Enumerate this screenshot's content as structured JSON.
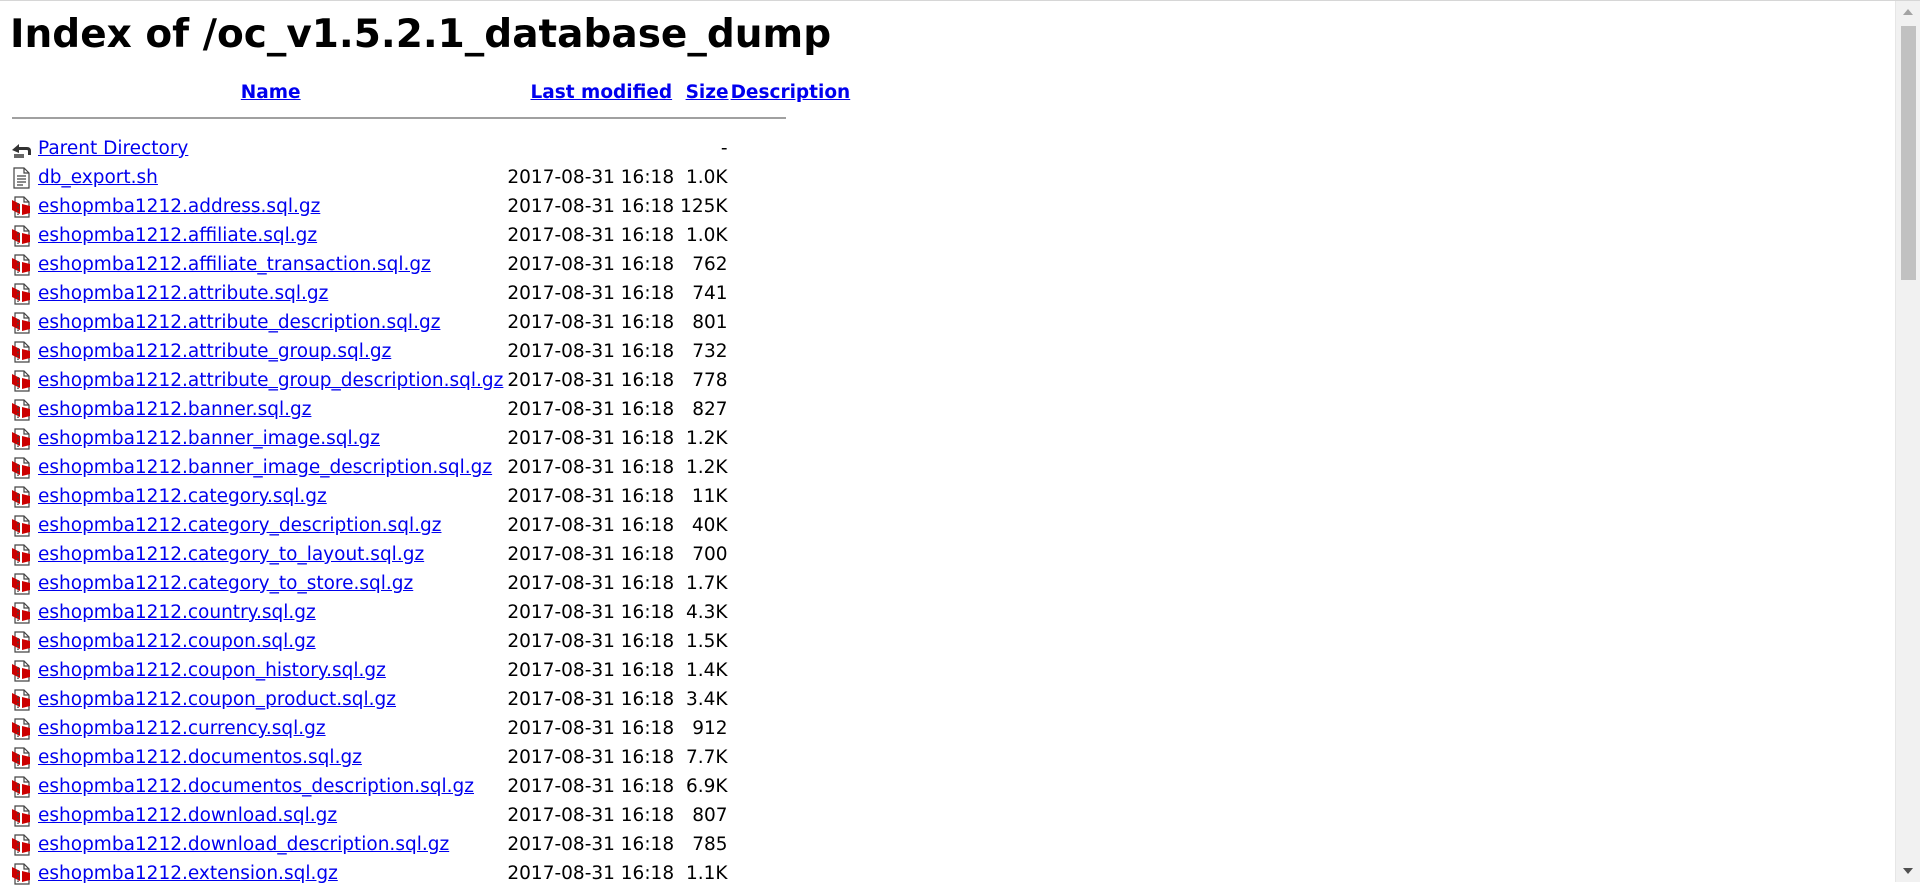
{
  "page": {
    "title": "Index of /oc_v1.5.2.1_database_dump"
  },
  "table": {
    "headers": {
      "name": "Name",
      "last_modified": "Last modified",
      "size": "Size",
      "description": "Description"
    },
    "parent": {
      "name": "Parent Directory",
      "size": "-",
      "icon": "back-icon"
    },
    "rows": [
      {
        "name": "db_export.sh",
        "date": "2017-08-31 16:18",
        "size": "1.0K",
        "icon": "text-file-icon"
      },
      {
        "name": "eshopmba1212.address.sql.gz",
        "date": "2017-08-31 16:18",
        "size": "125K",
        "icon": "compressed-file-icon"
      },
      {
        "name": "eshopmba1212.affiliate.sql.gz",
        "date": "2017-08-31 16:18",
        "size": "1.0K",
        "icon": "compressed-file-icon"
      },
      {
        "name": "eshopmba1212.affiliate_transaction.sql.gz",
        "date": "2017-08-31 16:18",
        "size": "762",
        "icon": "compressed-file-icon"
      },
      {
        "name": "eshopmba1212.attribute.sql.gz",
        "date": "2017-08-31 16:18",
        "size": "741",
        "icon": "compressed-file-icon"
      },
      {
        "name": "eshopmba1212.attribute_description.sql.gz",
        "date": "2017-08-31 16:18",
        "size": "801",
        "icon": "compressed-file-icon"
      },
      {
        "name": "eshopmba1212.attribute_group.sql.gz",
        "date": "2017-08-31 16:18",
        "size": "732",
        "icon": "compressed-file-icon"
      },
      {
        "name": "eshopmba1212.attribute_group_description.sql.gz",
        "date": "2017-08-31 16:18",
        "size": "778",
        "icon": "compressed-file-icon"
      },
      {
        "name": "eshopmba1212.banner.sql.gz",
        "date": "2017-08-31 16:18",
        "size": "827",
        "icon": "compressed-file-icon"
      },
      {
        "name": "eshopmba1212.banner_image.sql.gz",
        "date": "2017-08-31 16:18",
        "size": "1.2K",
        "icon": "compressed-file-icon"
      },
      {
        "name": "eshopmba1212.banner_image_description.sql.gz",
        "date": "2017-08-31 16:18",
        "size": "1.2K",
        "icon": "compressed-file-icon"
      },
      {
        "name": "eshopmba1212.category.sql.gz",
        "date": "2017-08-31 16:18",
        "size": "11K",
        "icon": "compressed-file-icon"
      },
      {
        "name": "eshopmba1212.category_description.sql.gz",
        "date": "2017-08-31 16:18",
        "size": "40K",
        "icon": "compressed-file-icon"
      },
      {
        "name": "eshopmba1212.category_to_layout.sql.gz",
        "date": "2017-08-31 16:18",
        "size": "700",
        "icon": "compressed-file-icon"
      },
      {
        "name": "eshopmba1212.category_to_store.sql.gz",
        "date": "2017-08-31 16:18",
        "size": "1.7K",
        "icon": "compressed-file-icon"
      },
      {
        "name": "eshopmba1212.country.sql.gz",
        "date": "2017-08-31 16:18",
        "size": "4.3K",
        "icon": "compressed-file-icon"
      },
      {
        "name": "eshopmba1212.coupon.sql.gz",
        "date": "2017-08-31 16:18",
        "size": "1.5K",
        "icon": "compressed-file-icon"
      },
      {
        "name": "eshopmba1212.coupon_history.sql.gz",
        "date": "2017-08-31 16:18",
        "size": "1.4K",
        "icon": "compressed-file-icon"
      },
      {
        "name": "eshopmba1212.coupon_product.sql.gz",
        "date": "2017-08-31 16:18",
        "size": "3.4K",
        "icon": "compressed-file-icon"
      },
      {
        "name": "eshopmba1212.currency.sql.gz",
        "date": "2017-08-31 16:18",
        "size": "912",
        "icon": "compressed-file-icon"
      },
      {
        "name": "eshopmba1212.documentos.sql.gz",
        "date": "2017-08-31 16:18",
        "size": "7.7K",
        "icon": "compressed-file-icon"
      },
      {
        "name": "eshopmba1212.documentos_description.sql.gz",
        "date": "2017-08-31 16:18",
        "size": "6.9K",
        "icon": "compressed-file-icon"
      },
      {
        "name": "eshopmba1212.download.sql.gz",
        "date": "2017-08-31 16:18",
        "size": "807",
        "icon": "compressed-file-icon"
      },
      {
        "name": "eshopmba1212.download_description.sql.gz",
        "date": "2017-08-31 16:18",
        "size": "785",
        "icon": "compressed-file-icon"
      },
      {
        "name": "eshopmba1212.extension.sql.gz",
        "date": "2017-08-31 16:18",
        "size": "1.1K",
        "icon": "compressed-file-icon"
      }
    ]
  },
  "colors": {
    "link": "#0000ee",
    "icon_red": "#cc0000",
    "rule": "#a0a0a0"
  }
}
